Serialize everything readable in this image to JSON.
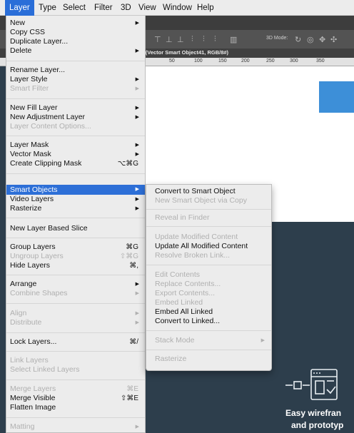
{
  "menubar": {
    "items": [
      "Layer",
      "Type",
      "Select",
      "Filter",
      "3D",
      "View",
      "Window",
      "Help"
    ],
    "active": "Layer"
  },
  "document": {
    "tab_title": "% (Vector Smart Object41, RGB/8#)",
    "options_label": "3D Mode:",
    "ruler_ticks": [
      "50",
      "100",
      "150",
      "200",
      "250",
      "300",
      "350"
    ],
    "headline_line1": "Easy wirefran",
    "headline_line2": "and prototyp"
  },
  "layer_menu": {
    "items": [
      {
        "label": "New",
        "submenu": true
      },
      {
        "label": "Copy CSS"
      },
      {
        "label": "Duplicate Layer..."
      },
      {
        "label": "Delete",
        "submenu": true
      },
      {
        "label": "Rename Layer..."
      },
      {
        "label": "Layer Style",
        "submenu": true
      },
      {
        "label": "Smart Filter",
        "submenu": true,
        "disabled": true
      },
      {
        "label": "New Fill Layer",
        "submenu": true
      },
      {
        "label": "New Adjustment Layer",
        "submenu": true
      },
      {
        "label": "Layer Content Options...",
        "disabled": true
      },
      {
        "label": "Layer Mask",
        "submenu": true
      },
      {
        "label": "Vector Mask",
        "submenu": true
      },
      {
        "label": "Create Clipping Mask",
        "shortcut": "⌥⌘G"
      },
      {
        "label": "Smart Objects",
        "submenu": true,
        "highlighted": true
      },
      {
        "label": "Video Layers",
        "submenu": true
      },
      {
        "label": "Rasterize",
        "submenu": true
      },
      {
        "label": "New Layer Based Slice"
      },
      {
        "label": "Group Layers",
        "shortcut": "⌘G"
      },
      {
        "label": "Ungroup Layers",
        "shortcut": "⇧⌘G",
        "disabled": true
      },
      {
        "label": "Hide Layers",
        "shortcut": "⌘,"
      },
      {
        "label": "Arrange",
        "submenu": true
      },
      {
        "label": "Combine Shapes",
        "submenu": true,
        "disabled": true
      },
      {
        "label": "Align",
        "submenu": true,
        "disabled": true
      },
      {
        "label": "Distribute",
        "submenu": true,
        "disabled": true
      },
      {
        "label": "Lock Layers...",
        "shortcut": "⌘/"
      },
      {
        "label": "Link Layers",
        "disabled": true
      },
      {
        "label": "Select Linked Layers",
        "disabled": true
      },
      {
        "label": "Merge Layers",
        "shortcut": "⌘E",
        "disabled": true
      },
      {
        "label": "Merge Visible",
        "shortcut": "⇧⌘E"
      },
      {
        "label": "Flatten Image"
      },
      {
        "label": "Matting",
        "submenu": true,
        "disabled": true
      }
    ]
  },
  "smart_objects_submenu": {
    "items": [
      {
        "label": "Convert to Smart Object"
      },
      {
        "label": "New Smart Object via Copy",
        "disabled": true
      },
      {
        "label": "Reveal in Finder",
        "disabled": true
      },
      {
        "label": "Update Modified Content",
        "disabled": true
      },
      {
        "label": "Update All Modified Content"
      },
      {
        "label": "Resolve Broken Link...",
        "disabled": true
      },
      {
        "label": "Edit Contents",
        "disabled": true
      },
      {
        "label": "Replace Contents...",
        "disabled": true
      },
      {
        "label": "Export Contents...",
        "disabled": true
      },
      {
        "label": "Embed Linked",
        "disabled": true
      },
      {
        "label": "Embed All Linked"
      },
      {
        "label": "Convert to Linked..."
      },
      {
        "label": "Stack Mode",
        "submenu": true,
        "disabled": true
      },
      {
        "label": "Rasterize",
        "disabled": true
      }
    ]
  },
  "colors": {
    "highlight": "#2d6fd7",
    "menu_bg": "#ececec",
    "disabled_text": "#b0b0b0",
    "canvas_dark": "#2d3e4c",
    "accent_blue": "#3d8fd8"
  }
}
